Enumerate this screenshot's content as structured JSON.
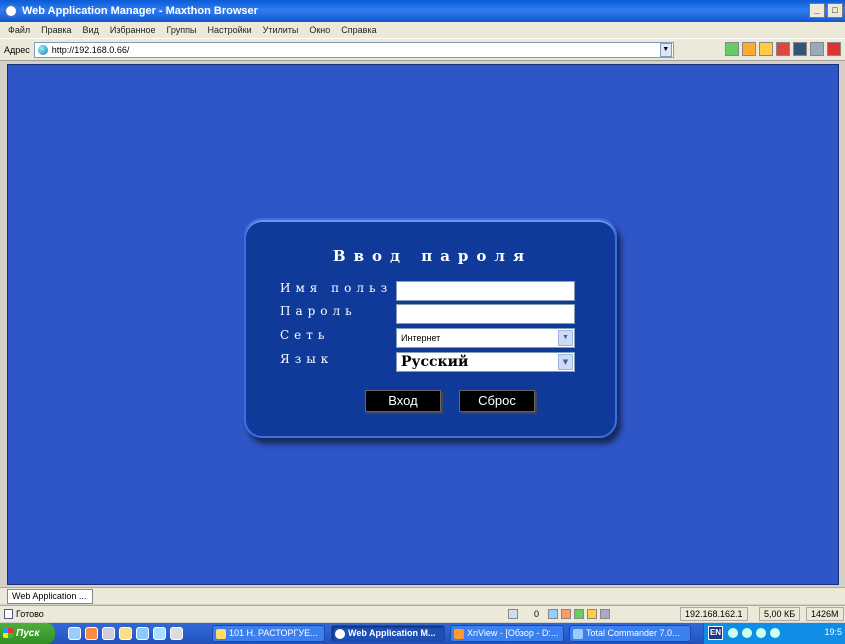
{
  "window": {
    "title": "Web Application Manager - Maxthon Browser",
    "controls": [
      "_",
      "□"
    ]
  },
  "menu": [
    "Файл",
    "Правка",
    "Вид",
    "Избранное",
    "Группы",
    "Настройки",
    "Утилиты",
    "Окно",
    "Справка"
  ],
  "address": {
    "label": "Адрес",
    "url": "http://192.168.0.66/"
  },
  "login": {
    "title": "Ввод пароля",
    "username_label": "Имя польз",
    "password_label": "Пароль",
    "network_label": "Сеть",
    "network_value": "Интернет",
    "language_label": "Язык",
    "language_value": "Русский",
    "login_button": "Вход",
    "reset_button": "Сброс"
  },
  "tab": {
    "label": "Web Application ..."
  },
  "status": {
    "text": "Готово",
    "count": "0",
    "ip": "192.168.162.1",
    "size": "5,00 КБ",
    "memory": "1426М"
  },
  "taskbar": {
    "start": "Пуск",
    "tasks": [
      "101 Н. РАСТОРГУЕ...",
      "Web Application M...",
      "XnView - [Обзор - D:...",
      "Total Commander 7.0..."
    ],
    "lang": "EN",
    "clock": "19:5"
  }
}
